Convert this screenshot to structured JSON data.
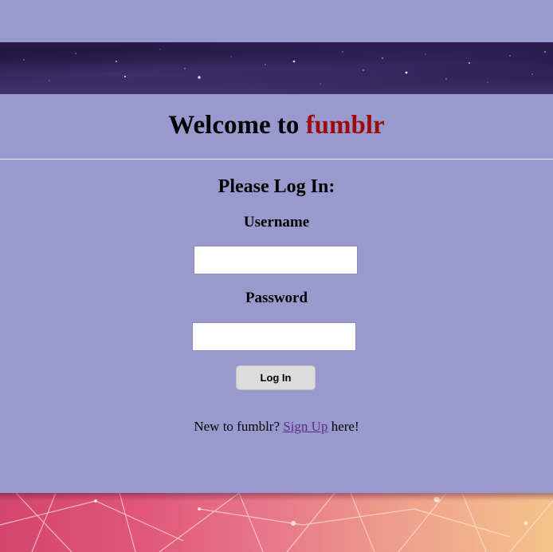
{
  "header": {
    "title_prefix": "Welcome to ",
    "brand": "fumblr"
  },
  "login": {
    "heading": "Please Log In:",
    "username_label": "Username",
    "username_value": "",
    "password_label": "Password",
    "password_value": "",
    "submit_label": "Log In"
  },
  "signup": {
    "prefix": "New to fumblr? ",
    "link_label": "Sign Up",
    "suffix": " here!"
  },
  "colors": {
    "background": "#9a99cd",
    "brand": "#9b0b0b",
    "link": "#5c2a8f"
  }
}
